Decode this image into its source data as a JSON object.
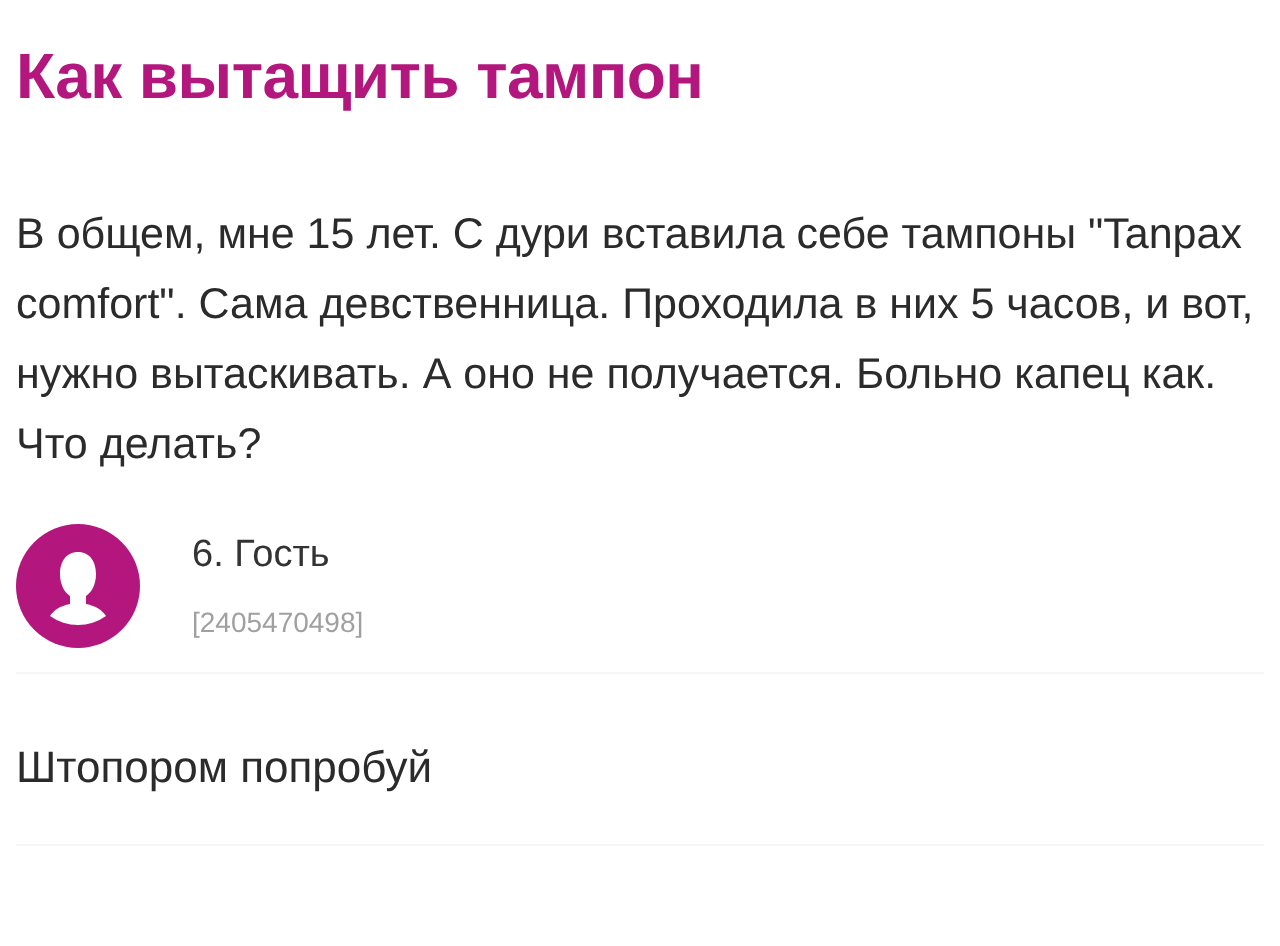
{
  "title": "Как вытащить тампон",
  "post": {
    "text": "В общем, мне 15 лет. С дури вставила себе тампоны \"Tanpax comfort\". Сама девственница. Проходила в них 5 часов, и вот, нужно вытаскивать. А оно не получается. Больно капец как. Что делать?"
  },
  "reply": {
    "author": "6. Гость",
    "id": "[2405470498]",
    "text": "Штопором попробуй"
  }
}
